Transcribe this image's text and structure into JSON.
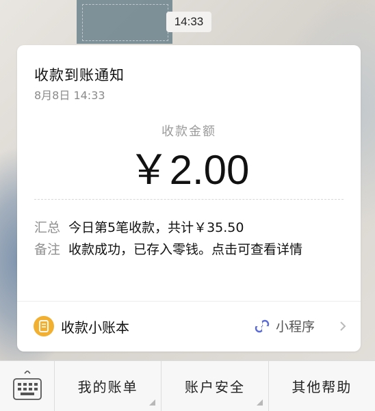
{
  "status": {
    "time": "14:33"
  },
  "notification": {
    "title": "收款到账通知",
    "date": "8月8日  14:33",
    "amount_label": "收款金额",
    "amount": "￥2.00",
    "summary": {
      "key": "汇总",
      "value": "今日第5笔收款，共计￥35.50"
    },
    "remark": {
      "key": "备注",
      "value": "收款成功，已存入零钱。点击可查看详情"
    },
    "footer": {
      "ledger_label": "收款小账本",
      "ledger_icon": "ledger-icon",
      "mini_program_label": "小程序",
      "mini_program_icon": "mini-program-icon",
      "arrow_icon": "chevron-right-icon"
    }
  },
  "bottom_menu": {
    "keyboard_icon": "keyboard-icon",
    "items": [
      {
        "label": "我的账单"
      },
      {
        "label": "账户安全"
      },
      {
        "label": "其他帮助"
      }
    ]
  },
  "colors": {
    "card_bg": "#ffffff",
    "ledger_accent": "#f2b032",
    "mini_program_accent": "#5b6bd6",
    "muted_text": "#8f8f8f"
  }
}
